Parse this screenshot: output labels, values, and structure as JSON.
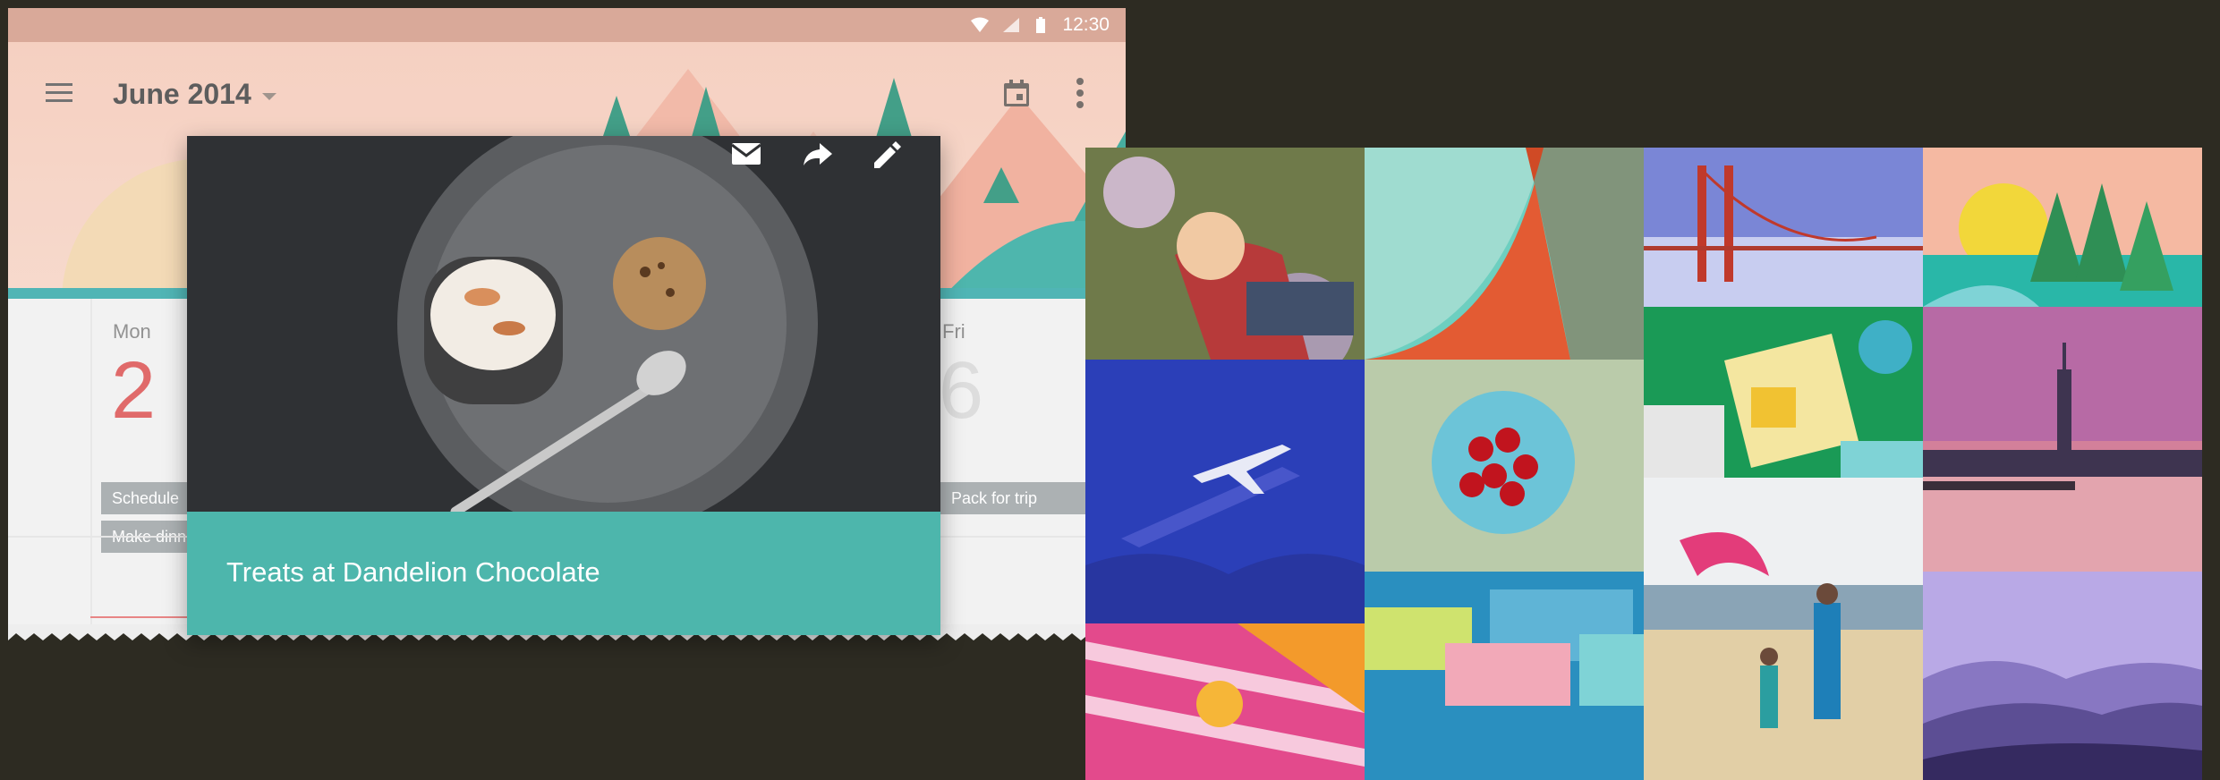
{
  "status_bar": {
    "time": "12:30",
    "icons": [
      "wifi-icon",
      "signal-icon",
      "battery-icon"
    ]
  },
  "toolbar": {
    "title": "June 2014",
    "icons": [
      "menu-icon",
      "dropdown-caret-icon",
      "calendar-icon",
      "more-vert-icon"
    ]
  },
  "calendar": {
    "days": [
      {
        "name": "Mon",
        "number": "2"
      },
      {
        "name": "Fri",
        "number": "6"
      }
    ],
    "events": [
      {
        "label": "Schedule"
      },
      {
        "label": "Make dinn"
      },
      {
        "label": "Pack for trip"
      }
    ]
  },
  "card": {
    "title": "Treats at Dandelion Chocolate",
    "actions": [
      "email-icon",
      "share-icon",
      "edit-icon"
    ],
    "caption_color": "#4db6ac"
  },
  "colors": {
    "background": "#2d2b22",
    "header_peach": "#f3c6b4",
    "teal_band": "#2aa5a5",
    "event_red": "#d94a4a"
  },
  "gallery": {
    "tiles": [
      "girl-in-flowers",
      "material-shapes",
      "golden-gate-bridge",
      "sunset-forest-illustration",
      "airplane-illustration",
      "cherries-bowl",
      "desk-illustration",
      "city-skyline-sunset",
      "beach-family",
      "money-illustration",
      "striped-towel-orange",
      "purple-mountains"
    ]
  }
}
